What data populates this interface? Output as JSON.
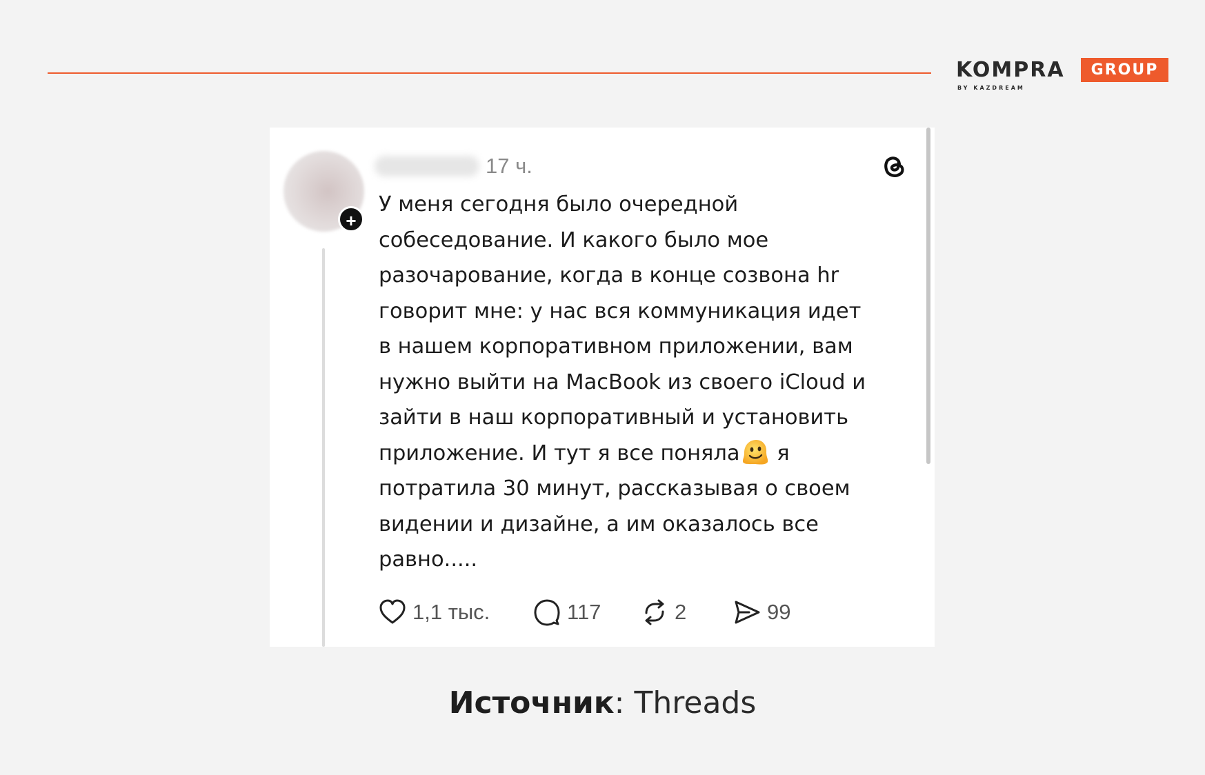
{
  "brand": {
    "name": "KOMPRA",
    "badge": "GROUP",
    "sub": "BY KAZDREAM",
    "accent_color": "#ee5a2c"
  },
  "post": {
    "timestamp": "17 ч.",
    "text_before_emoji": "У меня сегодня было очередной\nсобеседование. И какого было мое\nразочарование, когда в конце созвона hr\nговорит мне: у нас вся коммуникация идет\nв нашем корпоративном приложении, вам\nнужно выйти на MacBook из своего iCloud и\nзайти в наш корпоративный и установить\nприложение. И тут я все поняла",
    "emoji": "melting-face",
    "text_after_emoji": " я\nпотратила 30 минут, рассказывая о своем\nвидении и дизайне, а им оказалось все\nравно.....",
    "likes": "1,1 тыс.",
    "replies": "117",
    "reposts": "2",
    "shares": "99",
    "app_icon": "threads-logo-icon"
  },
  "caption": {
    "label": "Источник",
    "separator": ": ",
    "source": "Threads"
  }
}
